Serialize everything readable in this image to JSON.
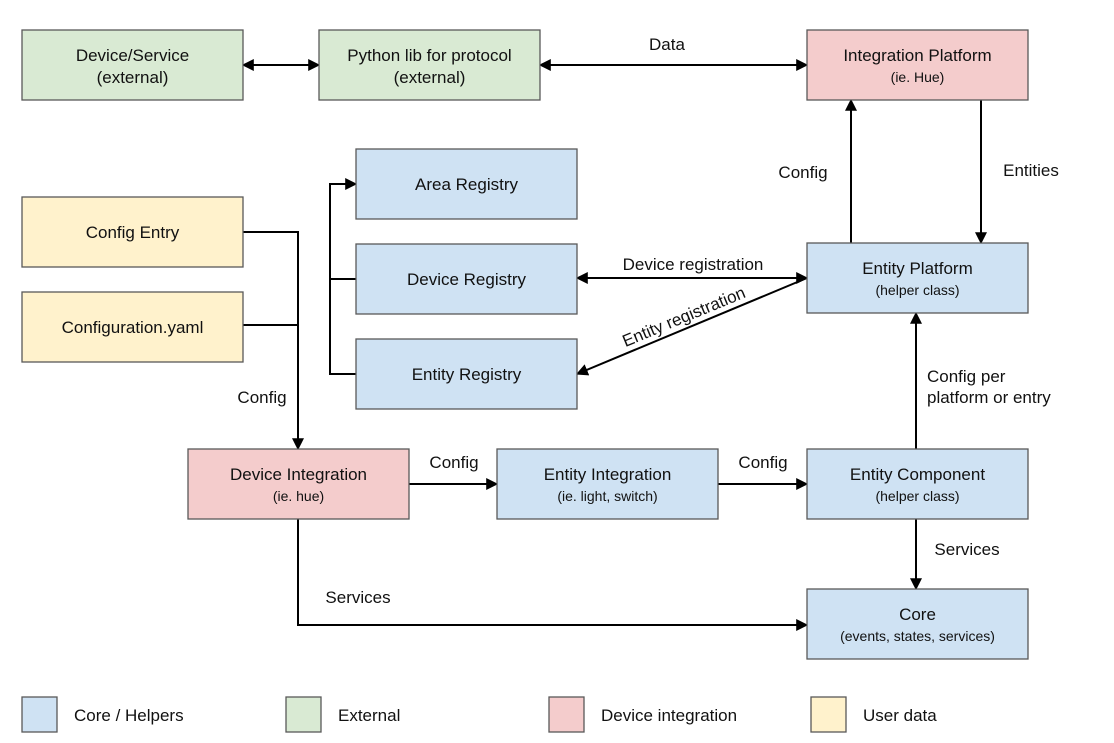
{
  "colors": {
    "core_helpers": "#cfe2f3",
    "external": "#d9ead3",
    "device_integration": "#f4cccc",
    "user_data": "#fff2cc"
  },
  "nodes": [
    {
      "id": "device_service",
      "title": "Device/Service",
      "subtitle": "(external)",
      "category": "external",
      "sub_large": true
    },
    {
      "id": "python_lib",
      "title": "Python lib for protocol",
      "subtitle": "(external)",
      "category": "external",
      "sub_large": true
    },
    {
      "id": "integration_platform",
      "title": "Integration Platform",
      "subtitle": "(ie. Hue)",
      "category": "device_integration"
    },
    {
      "id": "area_registry",
      "title": "Area Registry",
      "subtitle": "",
      "category": "core_helpers"
    },
    {
      "id": "config_entry",
      "title": "Config Entry",
      "subtitle": "",
      "category": "user_data"
    },
    {
      "id": "device_registry",
      "title": "Device Registry",
      "subtitle": "",
      "category": "core_helpers"
    },
    {
      "id": "entity_platform",
      "title": "Entity Platform",
      "subtitle": "(helper class)",
      "category": "core_helpers"
    },
    {
      "id": "configuration_yaml",
      "title": "Configuration.yaml",
      "subtitle": "",
      "category": "user_data"
    },
    {
      "id": "entity_registry",
      "title": "Entity Registry",
      "subtitle": "",
      "category": "core_helpers"
    },
    {
      "id": "device_integration",
      "title": "Device Integration",
      "subtitle": "(ie. hue)",
      "category": "device_integration"
    },
    {
      "id": "entity_integration",
      "title": "Entity Integration",
      "subtitle": "(ie. light, switch)",
      "category": "core_helpers"
    },
    {
      "id": "entity_component",
      "title": "Entity Component",
      "subtitle": "(helper class)",
      "category": "core_helpers"
    },
    {
      "id": "core",
      "title": "Core",
      "subtitle": "(events, states, services)",
      "category": "core_helpers"
    }
  ],
  "edges": [
    {
      "from": "device_service",
      "to": "python_lib",
      "label": "",
      "bidirectional": true
    },
    {
      "from": "python_lib",
      "to": "integration_platform",
      "label": "Data",
      "bidirectional": true
    },
    {
      "from": "entity_platform",
      "to": "integration_platform",
      "label": "Config"
    },
    {
      "from": "integration_platform",
      "to": "entity_platform",
      "label": "Entities"
    },
    {
      "from": "config_entry",
      "to": "device_integration",
      "label": "Config"
    },
    {
      "from": "configuration_yaml",
      "to": "device_integration",
      "label": ""
    },
    {
      "from": "device_registry",
      "to": "area_registry",
      "label": ""
    },
    {
      "from": "entity_registry",
      "to": "area_registry",
      "label": ""
    },
    {
      "from": "entity_platform",
      "to": "device_registry",
      "label": "Device registration",
      "bidirectional": true
    },
    {
      "from": "entity_platform",
      "to": "entity_registry",
      "label": "Entity registration"
    },
    {
      "from": "device_integration",
      "to": "entity_integration",
      "label": "Config"
    },
    {
      "from": "entity_integration",
      "to": "entity_component",
      "label": "Config"
    },
    {
      "from": "entity_component",
      "to": "entity_platform",
      "label": "Config per platform or entry",
      "label_lines": [
        "Config per",
        "platform or entry"
      ]
    },
    {
      "from": "entity_component",
      "to": "core",
      "label": "Services"
    },
    {
      "from": "device_integration",
      "to": "core",
      "label": "Services"
    }
  ],
  "legend": [
    {
      "category": "core_helpers",
      "label": "Core / Helpers"
    },
    {
      "category": "external",
      "label": "External"
    },
    {
      "category": "device_integration",
      "label": "Device integration"
    },
    {
      "category": "user_data",
      "label": "User data"
    }
  ]
}
